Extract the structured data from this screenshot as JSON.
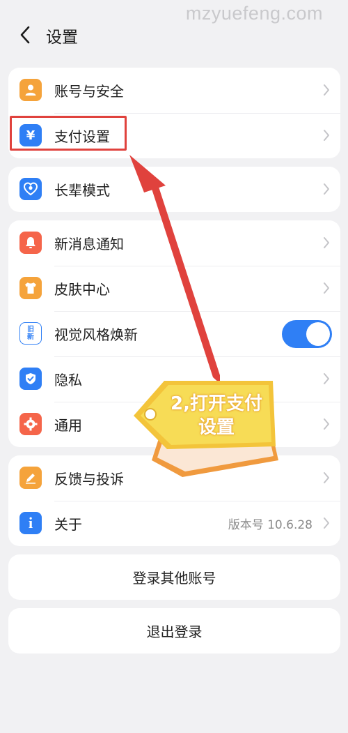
{
  "watermark": "mzyuefeng.com",
  "header": {
    "title": "设置"
  },
  "groups": [
    {
      "items": [
        {
          "label": "账号与安全",
          "icon": "person-icon",
          "color": "#f5a33b"
        },
        {
          "label": "支付设置",
          "icon": "yen-icon",
          "color": "#2f7ff5"
        }
      ]
    },
    {
      "items": [
        {
          "label": "长辈模式",
          "icon": "heart-icon",
          "color": "#2f7ff5"
        }
      ]
    },
    {
      "items": [
        {
          "label": "新消息通知",
          "icon": "bell-icon",
          "color": "#f5654a"
        },
        {
          "label": "皮肤中心",
          "icon": "shirt-icon",
          "color": "#f5a33b"
        },
        {
          "label": "视觉风格焕新",
          "icon": "refresh-style-icon",
          "color": "#2f7ff5",
          "toggle": true
        },
        {
          "label": "隐私",
          "icon": "shield-icon",
          "color": "#2f7ff5"
        },
        {
          "label": "通用",
          "icon": "gear-icon",
          "color": "#f5654a"
        }
      ]
    },
    {
      "items": [
        {
          "label": "反馈与投诉",
          "icon": "pencil-icon",
          "color": "#f5a33b"
        },
        {
          "label": "关于",
          "icon": "info-icon",
          "color": "#2f7ff5",
          "value": "版本号 10.6.28"
        }
      ]
    }
  ],
  "buttons": {
    "switch_account": "登录其他账号",
    "logout": "退出登录"
  },
  "annotation": {
    "tag_line1": "2,打开支付",
    "tag_line2": "设置"
  },
  "colors": {
    "accent": "#2f7ff5",
    "highlight": "#e0423d",
    "background": "#f1f1f3"
  }
}
